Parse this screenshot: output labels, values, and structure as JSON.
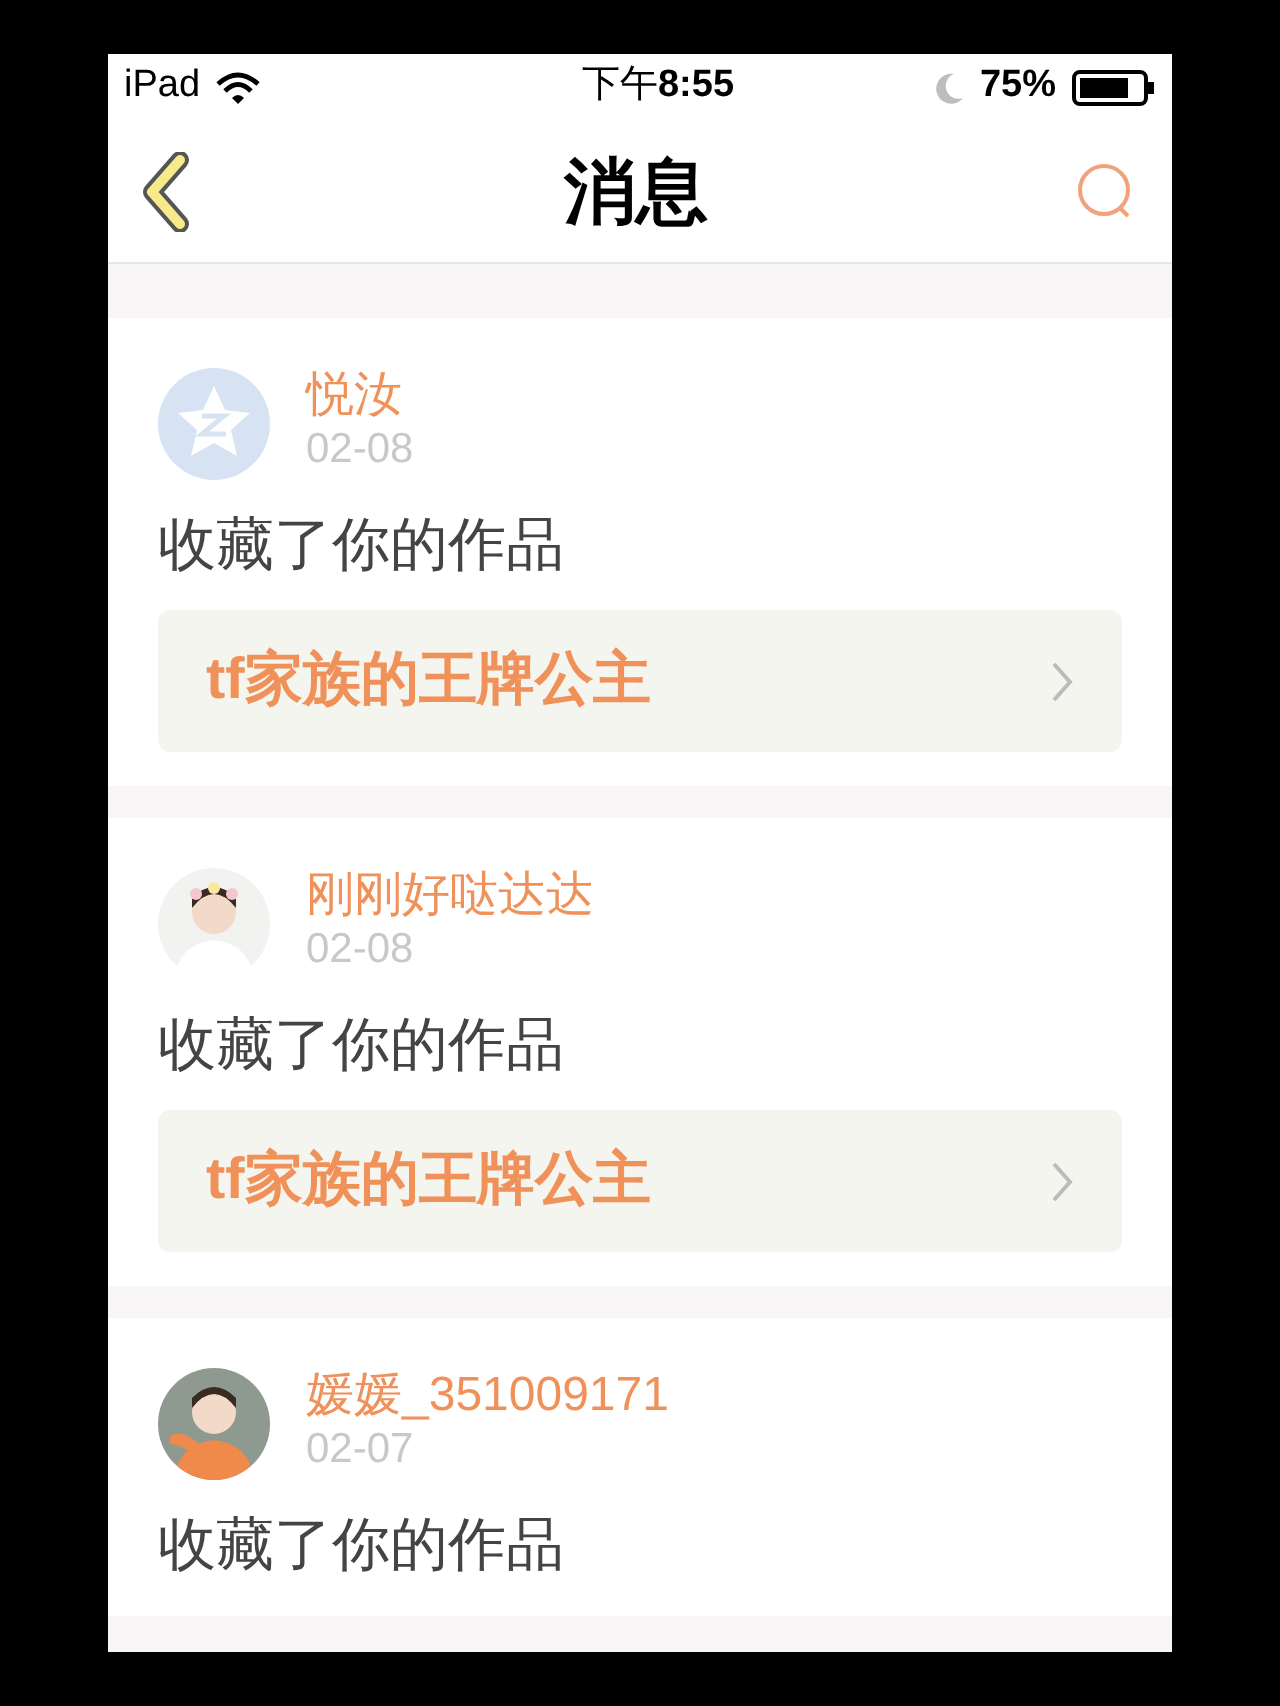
{
  "status_bar": {
    "device": "iPad",
    "time_prefix": "下午",
    "time": "8:55",
    "battery": "75%"
  },
  "nav": {
    "title": "消息"
  },
  "messages": [
    {
      "name": "悦汝",
      "date": "02-08",
      "action": "收藏了你的作品",
      "avatar": {
        "kind": "default"
      },
      "work": "tf家族的王牌公主"
    },
    {
      "name": "刚刚好哒达达",
      "date": "02-08",
      "action": "收藏了你的作品",
      "work": "tf家族的王牌公主"
    },
    {
      "name": "媛媛_351009171",
      "date": "02-07",
      "action": "收藏了你的作品"
    }
  ]
}
